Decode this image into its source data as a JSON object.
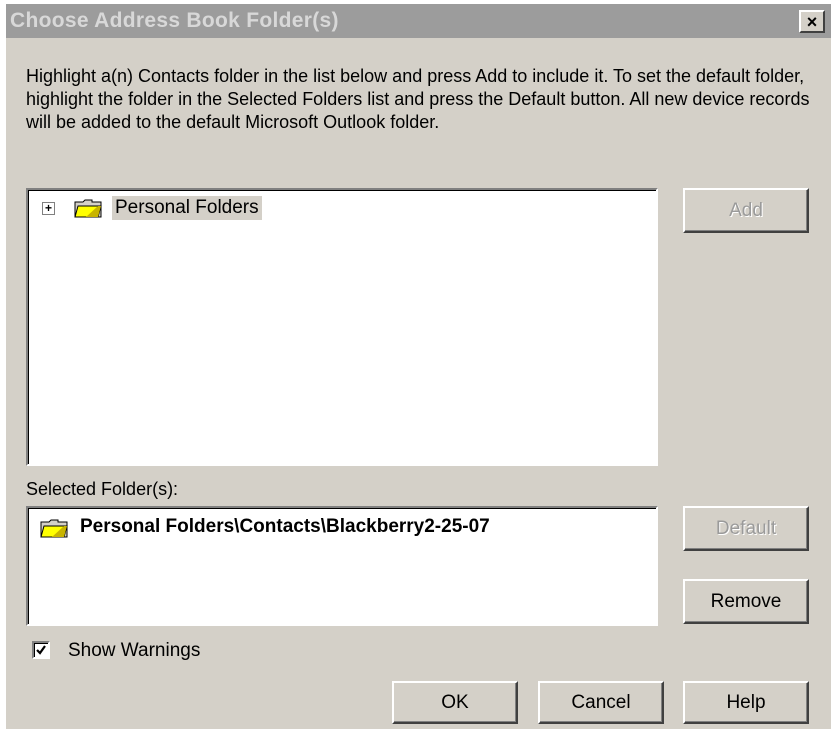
{
  "window": {
    "title": "Choose Address Book Folder(s)",
    "close_label": "×"
  },
  "instructions": "Highlight a(n) Contacts folder in the list below and press Add to include it.  To set the default folder, highlight the folder in the Selected Folders list and press the Default button.  All new device records will be added to the default Microsoft Outlook folder.",
  "tree": {
    "items": [
      {
        "label": "Personal Folders",
        "expand_symbol": "+",
        "icon": "folder-icon",
        "selected": true
      }
    ]
  },
  "buttons": {
    "add": "Add",
    "default": "Default",
    "remove": "Remove",
    "ok": "OK",
    "cancel": "Cancel",
    "help": "Help"
  },
  "selected_folders": {
    "caption": "Selected Folder(s):",
    "items": [
      {
        "label": "Personal Folders\\Contacts\\Blackberry2-25-07",
        "icon": "folder-icon"
      }
    ]
  },
  "show_warnings": {
    "label": "Show Warnings",
    "checked": true
  },
  "colors": {
    "dialog_bg": "#d4d0c8",
    "titlebar_inactive": "#9c9c9c",
    "folder_yellow": "#ffff00"
  }
}
